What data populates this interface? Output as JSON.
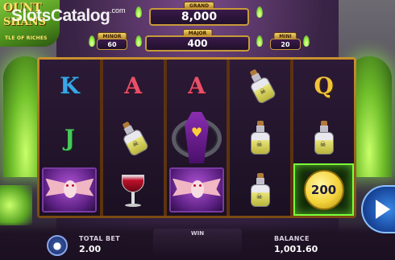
{
  "watermark": {
    "brand": "SlotsCatalog",
    "suffix": ".com"
  },
  "logo": {
    "line1": "OUNT",
    "line2": "SHANS",
    "tagline": "TLE OF RICHES"
  },
  "jackpots": {
    "grand": {
      "label": "GRAND",
      "value": "8,000"
    },
    "major": {
      "label": "MAJOR",
      "value": "400"
    },
    "minor": {
      "label": "MINOR",
      "value": "60"
    },
    "mini": {
      "label": "MINI",
      "value": "20"
    }
  },
  "reels": [
    [
      {
        "type": "letter",
        "text": "K"
      },
      {
        "type": "letter",
        "text": "J"
      },
      {
        "type": "bat"
      }
    ],
    [
      {
        "type": "letter",
        "text": "A"
      },
      {
        "type": "potion"
      },
      {
        "type": "wine"
      }
    ],
    [
      {
        "type": "letter",
        "text": "A"
      },
      {
        "type": "coffin"
      },
      {
        "type": "bat"
      }
    ],
    [
      {
        "type": "potion"
      },
      {
        "type": "potion"
      },
      {
        "type": "potion"
      }
    ],
    [
      {
        "type": "letter",
        "text": "Q"
      },
      {
        "type": "potion"
      },
      {
        "type": "coin",
        "text": "200"
      }
    ]
  ],
  "bottom_bar": {
    "total_bet_label": "TOTAL BET",
    "total_bet_value": "2.00",
    "win_label": "WIN",
    "win_value": "",
    "balance_label": "BALANCE",
    "balance_value": "1,001.60"
  },
  "colors": {
    "frame_gold": "#c89a3a",
    "highlight_green": "#7aff3a",
    "spin_blue": "#3a8ae8"
  },
  "icons": {
    "bet": "stack-coins-icon",
    "spin": "play-arrow-icon"
  }
}
